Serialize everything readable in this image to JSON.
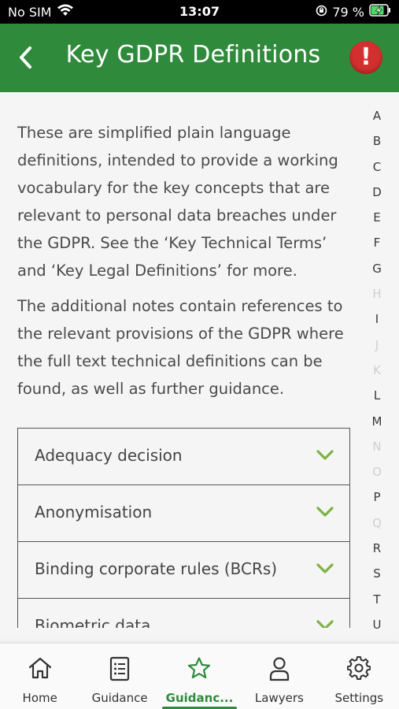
{
  "status": {
    "carrier": "No SIM",
    "time": "13:07",
    "battery": "79 %"
  },
  "header": {
    "title": "Key GDPR Definitions",
    "alert_symbol": "!",
    "accent_color": "#2f8a3b",
    "alert_color": "#d32f2f"
  },
  "intro": {
    "paragraph1": "These are simplified plain language definitions, intended to provide a working vocabulary for the key concepts that are relevant to personal data breaches under the GDPR. See the ‘Key Technical Terms’ and ‘Key Legal Definitions’ for more.",
    "paragraph2": "The additional notes contain references to the relevant provisions of the GDPR where the full text technical definitions can be found, as well as further guidance."
  },
  "definitions": [
    {
      "label": "Adequacy decision"
    },
    {
      "label": "Anonymisation"
    },
    {
      "label": "Binding corporate rules (BCRs)"
    },
    {
      "label": "Biometric data"
    }
  ],
  "alphabet": [
    {
      "letter": "A",
      "enabled": true
    },
    {
      "letter": "B",
      "enabled": true
    },
    {
      "letter": "C",
      "enabled": true
    },
    {
      "letter": "D",
      "enabled": true
    },
    {
      "letter": "E",
      "enabled": true
    },
    {
      "letter": "F",
      "enabled": true
    },
    {
      "letter": "G",
      "enabled": true
    },
    {
      "letter": "H",
      "enabled": false
    },
    {
      "letter": "I",
      "enabled": true
    },
    {
      "letter": "J",
      "enabled": false
    },
    {
      "letter": "K",
      "enabled": false
    },
    {
      "letter": "L",
      "enabled": true
    },
    {
      "letter": "M",
      "enabled": true
    },
    {
      "letter": "N",
      "enabled": false
    },
    {
      "letter": "O",
      "enabled": false
    },
    {
      "letter": "P",
      "enabled": true
    },
    {
      "letter": "Q",
      "enabled": false
    },
    {
      "letter": "R",
      "enabled": true
    },
    {
      "letter": "S",
      "enabled": true
    },
    {
      "letter": "T",
      "enabled": true
    },
    {
      "letter": "U",
      "enabled": true
    }
  ],
  "tabs": [
    {
      "label": "Home",
      "icon": "home-icon",
      "active": false
    },
    {
      "label": "Guidance",
      "icon": "list-icon",
      "active": false
    },
    {
      "label": "Guidanc...",
      "icon": "star-icon",
      "active": true
    },
    {
      "label": "Lawyers",
      "icon": "person-icon",
      "active": false
    },
    {
      "label": "Settings",
      "icon": "gear-icon",
      "active": false
    }
  ]
}
